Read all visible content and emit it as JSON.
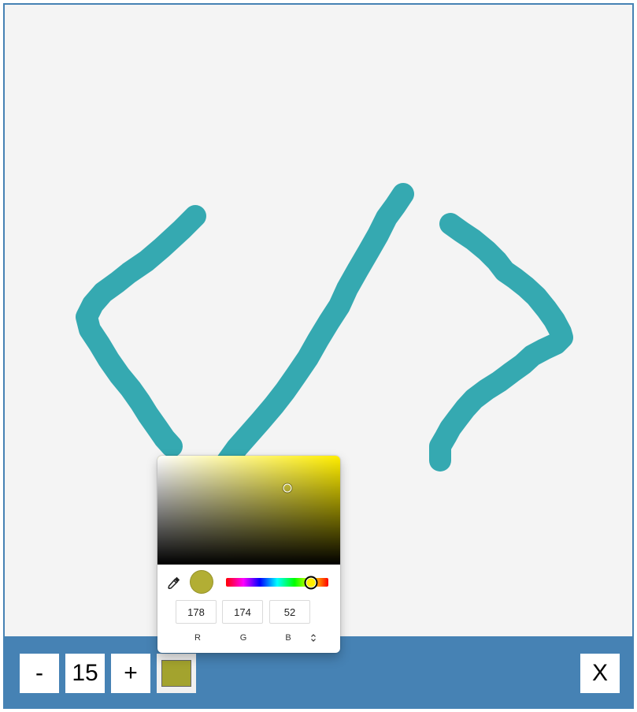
{
  "toolbar": {
    "decrease_label": "-",
    "brush_size": "15",
    "increase_label": "+",
    "close_label": "X",
    "toolbar_color": "#4682b4"
  },
  "canvas": {
    "background": "#f4f4f4",
    "stroke_color": "#35a9b1"
  },
  "current_color": {
    "swatch_hex": "#a3a32e",
    "preview_hex": "#b2ae34"
  },
  "color_picker": {
    "hue_color": "#ffee00",
    "hue_position": 0.83,
    "saturation": 0.71,
    "value": 0.7,
    "rgb": {
      "r": "178",
      "g": "174",
      "b": "52"
    },
    "labels": {
      "r": "R",
      "g": "G",
      "b": "B"
    },
    "icons": {
      "eyedropper": "eyedropper-icon",
      "mode_toggle": "chevron-up-down-icon"
    }
  }
}
